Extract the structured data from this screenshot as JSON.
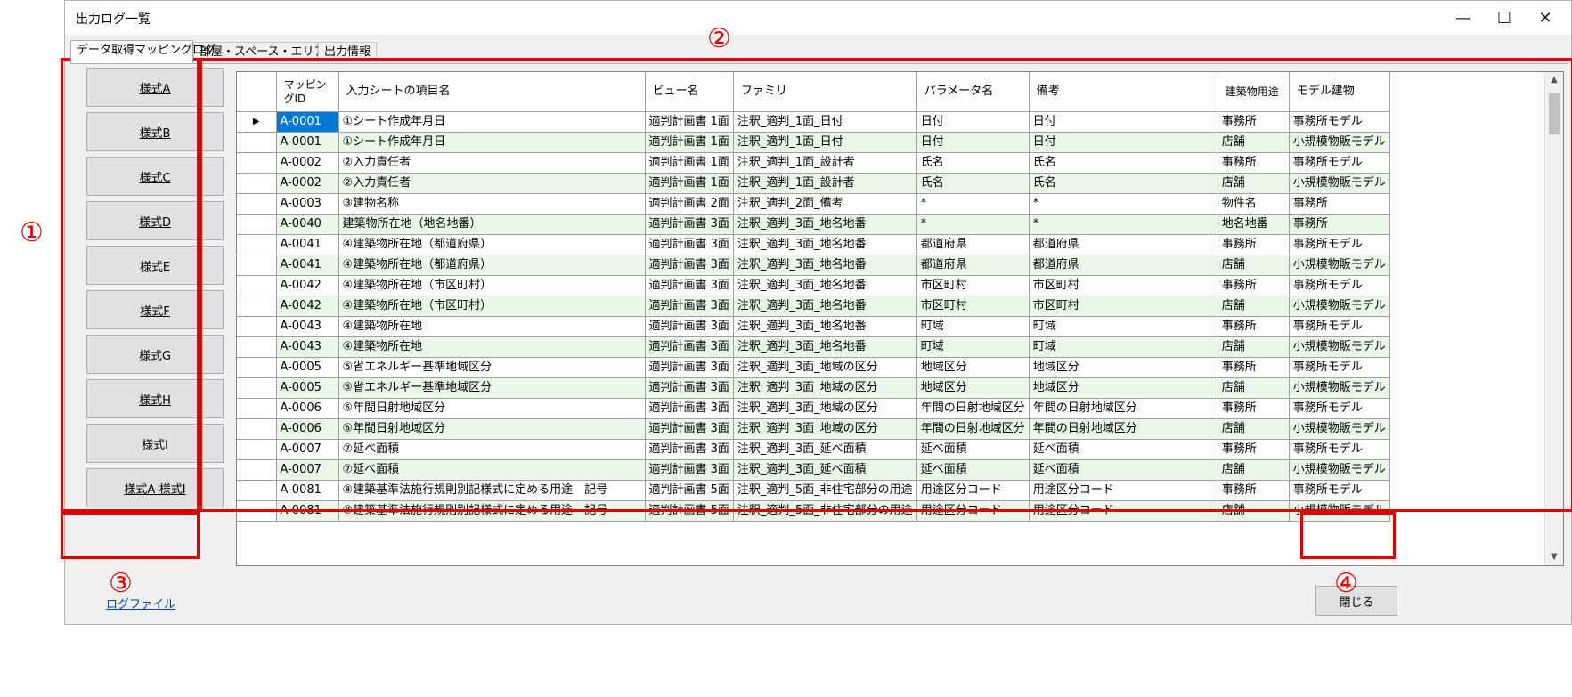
{
  "window": {
    "title": "出力ログ一覧",
    "minimize": "—",
    "maximize": "☐",
    "close": "✕"
  },
  "tabs": [
    {
      "label": "データ取得マッピングログ",
      "active": true
    },
    {
      "label": "部屋・スペース・エリアログ",
      "active": false
    },
    {
      "label": "出力情報",
      "active": false
    }
  ],
  "left_buttons": [
    "様式A",
    "様式B",
    "様式C",
    "様式D",
    "様式E",
    "様式F",
    "様式G",
    "様式H",
    "様式I",
    "様式A-様式I"
  ],
  "grid": {
    "columns": [
      "マッピングID",
      "入力シートの項目名",
      "ビュー名",
      "ファミリ",
      "パラメータ名",
      "備考",
      "建築物用途",
      "モデル建物"
    ],
    "current_row_marker": "▶",
    "rows": [
      [
        "A-0001",
        "①シート作成年月日",
        "適判計画書 1面",
        "注釈_適判_1面_日付",
        "日付",
        "日付",
        "事務所",
        "事務所モデル"
      ],
      [
        "A-0001",
        "①シート作成年月日",
        "適判計画書 1面",
        "注釈_適判_1面_日付",
        "日付",
        "日付",
        "店舗",
        "小規模物販モデル"
      ],
      [
        "A-0002",
        "②入力責任者",
        "適判計画書 1面",
        "注釈_適判_1面_設計者",
        "氏名",
        "氏名",
        "事務所",
        "事務所モデル"
      ],
      [
        "A-0002",
        "②入力責任者",
        "適判計画書 1面",
        "注釈_適判_1面_設計者",
        "氏名",
        "氏名",
        "店舗",
        "小規模物販モデル"
      ],
      [
        "A-0003",
        "③建物名称",
        "適判計画書 2面",
        "注釈_適判_2面_備考",
        "*",
        "*",
        "物件名",
        "事務所"
      ],
      [
        "A-0040",
        "建築物所在地（地名地番）",
        "適判計画書 3面",
        "注釈_適判_3面_地名地番",
        "*",
        "*",
        "地名地番",
        "事務所"
      ],
      [
        "A-0041",
        "④建築物所在地（都道府県）",
        "適判計画書 3面",
        "注釈_適判_3面_地名地番",
        "都道府県",
        "都道府県",
        "事務所",
        "事務所モデル"
      ],
      [
        "A-0041",
        "④建築物所在地（都道府県）",
        "適判計画書 3面",
        "注釈_適判_3面_地名地番",
        "都道府県",
        "都道府県",
        "店舗",
        "小規模物販モデル"
      ],
      [
        "A-0042",
        "④建築物所在地（市区町村）",
        "適判計画書 3面",
        "注釈_適判_3面_地名地番",
        "市区町村",
        "市区町村",
        "事務所",
        "事務所モデル"
      ],
      [
        "A-0042",
        "④建築物所在地（市区町村）",
        "適判計画書 3面",
        "注釈_適判_3面_地名地番",
        "市区町村",
        "市区町村",
        "店舗",
        "小規模物販モデル"
      ],
      [
        "A-0043",
        "④建築物所在地",
        "適判計画書 3面",
        "注釈_適判_3面_地名地番",
        "町域",
        "町域",
        "事務所",
        "事務所モデル"
      ],
      [
        "A-0043",
        "④建築物所在地",
        "適判計画書 3面",
        "注釈_適判_3面_地名地番",
        "町域",
        "町域",
        "店舗",
        "小規模物販モデル"
      ],
      [
        "A-0005",
        "⑤省エネルギー基準地域区分",
        "適判計画書 3面",
        "注釈_適判_3面_地域の区分",
        "地域区分",
        "地域区分",
        "事務所",
        "事務所モデル"
      ],
      [
        "A-0005",
        "⑤省エネルギー基準地域区分",
        "適判計画書 3面",
        "注釈_適判_3面_地域の区分",
        "地域区分",
        "地域区分",
        "店舗",
        "小規模物販モデル"
      ],
      [
        "A-0006",
        "⑥年間日射地域区分",
        "適判計画書 3面",
        "注釈_適判_3面_地域の区分",
        "年間の日射地域区分",
        "年間の日射地域区分",
        "事務所",
        "事務所モデル"
      ],
      [
        "A-0006",
        "⑥年間日射地域区分",
        "適判計画書 3面",
        "注釈_適判_3面_地域の区分",
        "年間の日射地域区分",
        "年間の日射地域区分",
        "店舗",
        "小規模物販モデル"
      ],
      [
        "A-0007",
        "⑦延べ面積",
        "適判計画書 3面",
        "注釈_適判_3面_延べ面積",
        "延べ面積",
        "延べ面積",
        "事務所",
        "事務所モデル"
      ],
      [
        "A-0007",
        "⑦延べ面積",
        "適判計画書 3面",
        "注釈_適判_3面_延べ面積",
        "延べ面積",
        "延べ面積",
        "店舗",
        "小規模物販モデル"
      ],
      [
        "A-0081",
        "⑧建築基準法施行規則別記様式に定める用途　記号",
        "適判計画書 5面",
        "注釈_適判_5面_非住宅部分の用途",
        "用途区分コード",
        "用途区分コード",
        "事務所",
        "事務所モデル"
      ],
      [
        "A-0081",
        "⑧建築基準法施行規則別記様式に定める用途　記号",
        "適判計画書 5面",
        "注釈_適判_5面_非住宅部分の用途",
        "用途区分コード",
        "用途区分コード",
        "店舗",
        "小規模物販モデル"
      ]
    ]
  },
  "footer": {
    "log_file": "ログファイル",
    "close": "閉じる"
  },
  "callouts": [
    "①",
    "②",
    "③",
    "④"
  ],
  "accent_color": "#e00000"
}
